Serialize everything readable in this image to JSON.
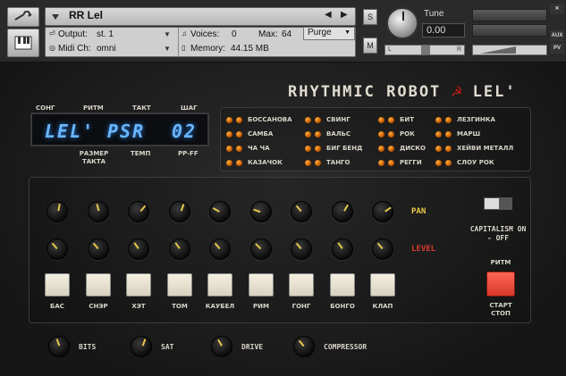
{
  "header": {
    "instrument_name": "RR Lel",
    "output_label": "Output:",
    "output_value": "st. 1",
    "voices_label": "Voices:",
    "voices_value": "0",
    "max_label": "Max:",
    "max_value": "64",
    "purge_label": "Purge",
    "midi_label": "Midi Ch:",
    "midi_value": "omni",
    "memory_label": "Memory:",
    "memory_value": "44.15 MB",
    "s_label": "S",
    "m_label": "M",
    "tune_label": "Tune",
    "tune_value": "0.00",
    "pan_left": "L",
    "pan_right": "R",
    "aux_label": "AUX",
    "pv_label": "PV"
  },
  "brand": {
    "title": "RHYTHMIC ROBOT",
    "suffix": "LEL'",
    "emblem": "☭"
  },
  "display": {
    "labels": {
      "song": "СОНГ",
      "rhythm": "РИТМ",
      "measure": "ТАКТ",
      "step": "ШАГ",
      "size": "РАЗМЕР ТАКТА",
      "tempo": "ТЕМП",
      "ppff": "PP-FF"
    },
    "song_value": "LEL'",
    "rhythm_value": "PSR",
    "step_value": "02"
  },
  "styles": [
    "БОССАНОВА",
    "САМБА",
    "ЧА ЧА",
    "КАЗАЧОК",
    "СВИНГ",
    "ВАЛЬС",
    "БИГ БЕНД",
    "ТАНГО",
    "БИТ",
    "РОК",
    "ДИСКО",
    "РЕГГИ",
    "ЛЕЗГИНКА",
    "МАРШ",
    "ХЕЙВИ МЕТАЛЛ",
    "СЛОУ РОК"
  ],
  "mixer": {
    "pan_row_label": "PAN",
    "level_row_label": "LEVEL",
    "pad_labels": [
      "БАС",
      "СНЭР",
      "ХЭТ",
      "ТОМ",
      "КАУБЕЛ",
      "РИМ",
      "ГОНГ",
      "БОНГО",
      "КЛАП"
    ],
    "capitalism_label": "CAPITALISM ON - OFF",
    "rhythm_label": "РИТМ",
    "start_stop_label": "СТАРТ СТОП",
    "pan_color": "#e8c84a",
    "level_color": "#d83a2a"
  },
  "effects": [
    "BITS",
    "SAT",
    "DRIVE",
    "COMPRESSOR"
  ],
  "colors": {
    "accent_led": "#ff8a1a",
    "display_text": "#6ab6ff",
    "start_button": "#f05040",
    "brand_red": "#c21a12"
  }
}
